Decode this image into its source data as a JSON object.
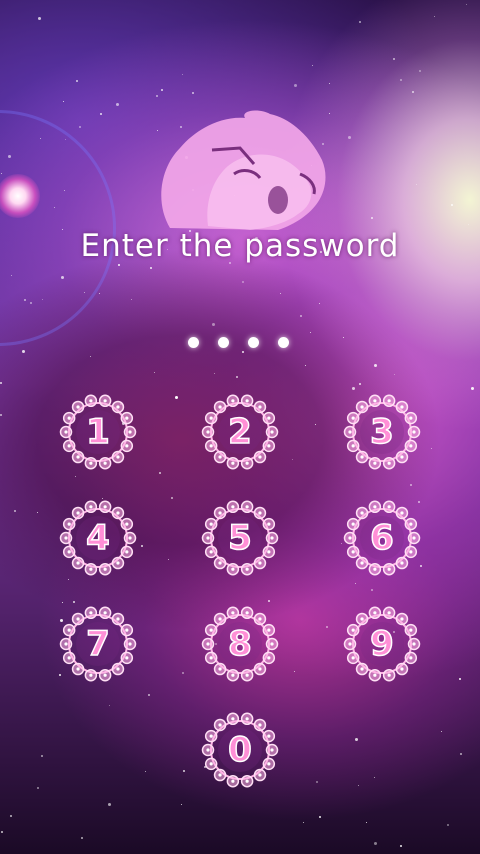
{
  "lock_screen": {
    "prompt": "Enter the password",
    "entered_digit_count": 4,
    "keypad": {
      "keys": [
        {
          "label": "1"
        },
        {
          "label": "2"
        },
        {
          "label": "3"
        },
        {
          "label": "4"
        },
        {
          "label": "5"
        },
        {
          "label": "6"
        },
        {
          "label": "7"
        },
        {
          "label": "8"
        },
        {
          "label": "9"
        },
        {
          "label": "0"
        }
      ]
    }
  },
  "icons": {
    "logo": "lion-head-icon",
    "key_frame": "flower-wreath-icon",
    "entered_digit": "filled-dot-icon"
  },
  "colors": {
    "key_number": "#ff8fd6",
    "key_wreath": "#ffb3e6",
    "text": "#ffffff",
    "logo": "#f2a6e8"
  }
}
